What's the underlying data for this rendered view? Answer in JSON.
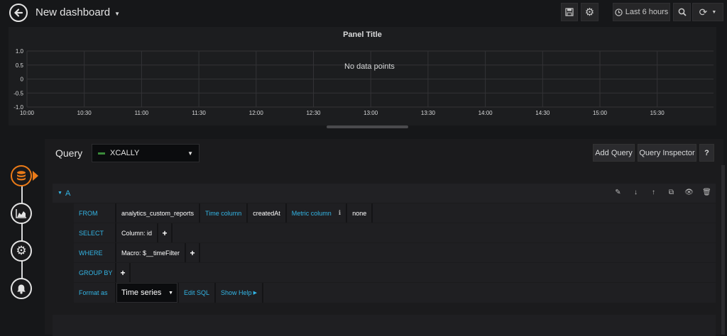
{
  "dashboard": {
    "title": "New dashboard"
  },
  "toolbar": {
    "time_range": "Last 6 hours"
  },
  "panel": {
    "title": "Panel Title",
    "no_data": "No data points",
    "y_ticks": [
      "1.0",
      "0.5",
      "0",
      "-0.5",
      "-1.0"
    ],
    "x_ticks": [
      "10:00",
      "10:30",
      "11:00",
      "11:30",
      "12:00",
      "12:30",
      "13:00",
      "13:30",
      "14:00",
      "14:30",
      "15:00",
      "15:30"
    ]
  },
  "editor": {
    "query_label": "Query",
    "datasource": "XCALLY",
    "add_query": "Add Query",
    "query_inspector": "Query Inspector",
    "help": "?",
    "ref_id": "A",
    "from": {
      "keyword": "FROM",
      "table": "analytics_custom_reports",
      "time_column_label": "Time column",
      "time_column_value": "createdAt",
      "metric_column_label": "Metric column",
      "metric_column_value": "none"
    },
    "select": {
      "keyword": "SELECT",
      "value": "Column: id"
    },
    "where": {
      "keyword": "WHERE",
      "value": "Macro: $__timeFilter"
    },
    "group_by": {
      "keyword": "GROUP BY"
    },
    "format": {
      "label": "Format as",
      "value": "Time series",
      "edit_sql": "Edit SQL",
      "show_help": "Show Help"
    }
  },
  "colors": {
    "accent": "#33b5e5",
    "active_rail": "#eb7b18",
    "background": "#161719"
  }
}
